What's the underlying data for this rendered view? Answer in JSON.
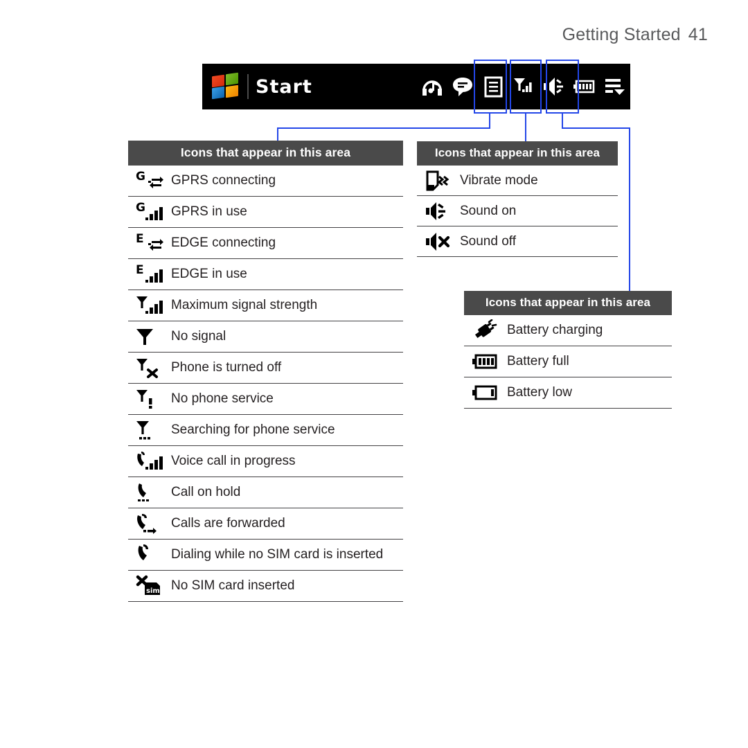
{
  "header": {
    "title": "Getting Started",
    "page_number": "41"
  },
  "taskbar": {
    "logo_icon": "windows-logo-icon",
    "start_label": "Start",
    "tray_icons": [
      {
        "name": "headphones-music-icon",
        "label": "Headphones"
      },
      {
        "name": "chat-bubble-icon",
        "label": "Messaging"
      },
      {
        "name": "notes-list-icon",
        "label": "Notes"
      },
      {
        "name": "signal-strength-icon",
        "label": "Signal",
        "highlighted": true
      },
      {
        "name": "speaker-sound-on-icon",
        "label": "Sound",
        "highlighted": true
      },
      {
        "name": "battery-full-icon",
        "label": "Battery",
        "highlighted": true
      },
      {
        "name": "menu-arrow-icon",
        "label": "Menu"
      }
    ]
  },
  "callout_color": "#2346e8",
  "header_bg_color": "#4a4a4a",
  "tables": [
    {
      "id": "signal",
      "header": "Icons that appear in this area",
      "rows": [
        {
          "icon": "gprs-connecting-icon",
          "label": "GPRS connecting"
        },
        {
          "icon": "gprs-in-use-icon",
          "label": "GPRS in use"
        },
        {
          "icon": "edge-connecting-icon",
          "label": "EDGE connecting"
        },
        {
          "icon": "edge-in-use-icon",
          "label": "EDGE in use"
        },
        {
          "icon": "max-signal-strength-icon",
          "label": "Maximum signal strength"
        },
        {
          "icon": "no-signal-icon",
          "label": "No signal"
        },
        {
          "icon": "phone-turned-off-icon",
          "label": "Phone is turned off"
        },
        {
          "icon": "no-phone-service-icon",
          "label": "No phone service"
        },
        {
          "icon": "searching-service-icon",
          "label": "Searching for phone service"
        },
        {
          "icon": "voice-call-in-progress-icon",
          "label": "Voice call in progress"
        },
        {
          "icon": "call-on-hold-icon",
          "label": "Call on hold"
        },
        {
          "icon": "calls-forwarded-icon",
          "label": "Calls are forwarded"
        },
        {
          "icon": "dialing-no-sim-icon",
          "label": "Dialing while no SIM card is inserted"
        },
        {
          "icon": "no-sim-card-icon",
          "label": "No SIM card inserted"
        }
      ]
    },
    {
      "id": "sound",
      "header": "Icons that appear in this area",
      "rows": [
        {
          "icon": "vibrate-mode-icon",
          "label": "Vibrate mode"
        },
        {
          "icon": "sound-on-icon",
          "label": "Sound on"
        },
        {
          "icon": "sound-off-icon",
          "label": "Sound off"
        }
      ]
    },
    {
      "id": "battery",
      "header": "Icons that appear in this area",
      "rows": [
        {
          "icon": "battery-charging-icon",
          "label": "Battery charging"
        },
        {
          "icon": "battery-full-icon",
          "label": "Battery full"
        },
        {
          "icon": "battery-low-icon",
          "label": "Battery low"
        }
      ]
    }
  ]
}
